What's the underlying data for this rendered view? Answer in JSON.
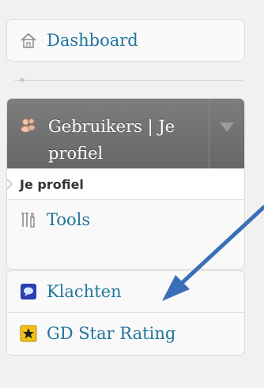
{
  "menu": {
    "dashboard": "Dashboard",
    "collapse_glyph": "«",
    "users_section": "Gebruikers | Je profiel",
    "users_sub_item": "Je profiel",
    "tools": "Tools",
    "complaints": "Klachten",
    "star_rating": "GD Star Rating"
  },
  "icons": {
    "dashboard": "home-icon",
    "users": "users-icon",
    "tools": "tools-icon",
    "complaints": "speech-bubble-icon",
    "star_rating": "star-icon"
  },
  "colors": {
    "link": "#21759b",
    "active_header": "#707070",
    "annotation_arrow": "#3a6fb8"
  }
}
